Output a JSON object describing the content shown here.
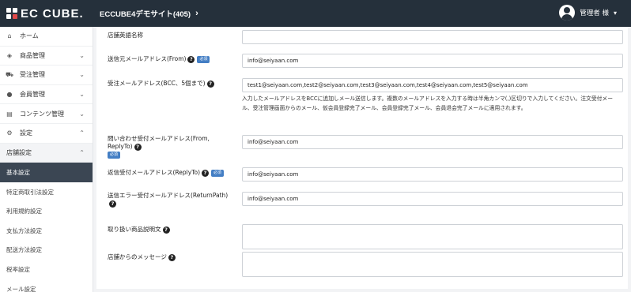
{
  "header": {
    "logo": "EC CUBE.",
    "site_name": "ECCUBE4デモサイト(405)",
    "user_name": "管理者 様"
  },
  "sidebar": {
    "items": [
      {
        "label": "ホーム",
        "icon": "home-icon",
        "glyph": "⌂"
      },
      {
        "label": "商品管理",
        "icon": "cube-icon",
        "glyph": "◈"
      },
      {
        "label": "受注管理",
        "icon": "cart-icon",
        "glyph": "🛒"
      },
      {
        "label": "会員管理",
        "icon": "users-icon",
        "glyph": "👥"
      },
      {
        "label": "コンテンツ管理",
        "icon": "file-icon",
        "glyph": "▤"
      },
      {
        "label": "設定",
        "icon": "gear-icon",
        "glyph": "⚙"
      }
    ],
    "sub_group": "店舗設定",
    "leaves": [
      {
        "label": "基本設定",
        "active": true
      },
      {
        "label": "特定商取引法設定",
        "active": false
      },
      {
        "label": "利用規約設定",
        "active": false
      },
      {
        "label": "支払方法設定",
        "active": false
      },
      {
        "label": "配送方法設定",
        "active": false
      },
      {
        "label": "税率設定",
        "active": false
      },
      {
        "label": "メール設定",
        "active": false
      }
    ]
  },
  "form": {
    "top_label": "店舗英語名称",
    "required_badge": "必須",
    "sender": {
      "label": "送信元メールアドレス(From)",
      "value": "info@seiyaan.com"
    },
    "bcc": {
      "label": "受注メールアドレス(BCC、5個まで)",
      "value": "test1@seiyaan.com,test2@seiyaan.com,test3@seiyaan.com,test4@seiyaan.com,test5@seiyaan.com",
      "hint": "入力したメールアドレスをBCCに追加しメール送信します。複数のメールアドレスを入力する時は半角カンマ(,)区切りで入力してください。注文受付メール、受注管理画面からのメール、仮会員登録完了メール、会員登録完了メール、会員退会完了メールに適用されます。"
    },
    "inquiry": {
      "label": "問い合わせ受付メールアドレス(From, ReplyTo)",
      "value": "info@seiyaan.com"
    },
    "reply": {
      "label": "返信受付メールアドレス(ReplyTo)",
      "value": "info@seiyaan.com"
    },
    "error": {
      "label": "送信エラー受付メールアドレス(ReturnPath)",
      "value": "info@seiyaan.com"
    },
    "goods": {
      "label": "取り扱い商品説明文",
      "value": ""
    },
    "message": {
      "label": "店舗からのメッセージ",
      "value": ""
    }
  }
}
